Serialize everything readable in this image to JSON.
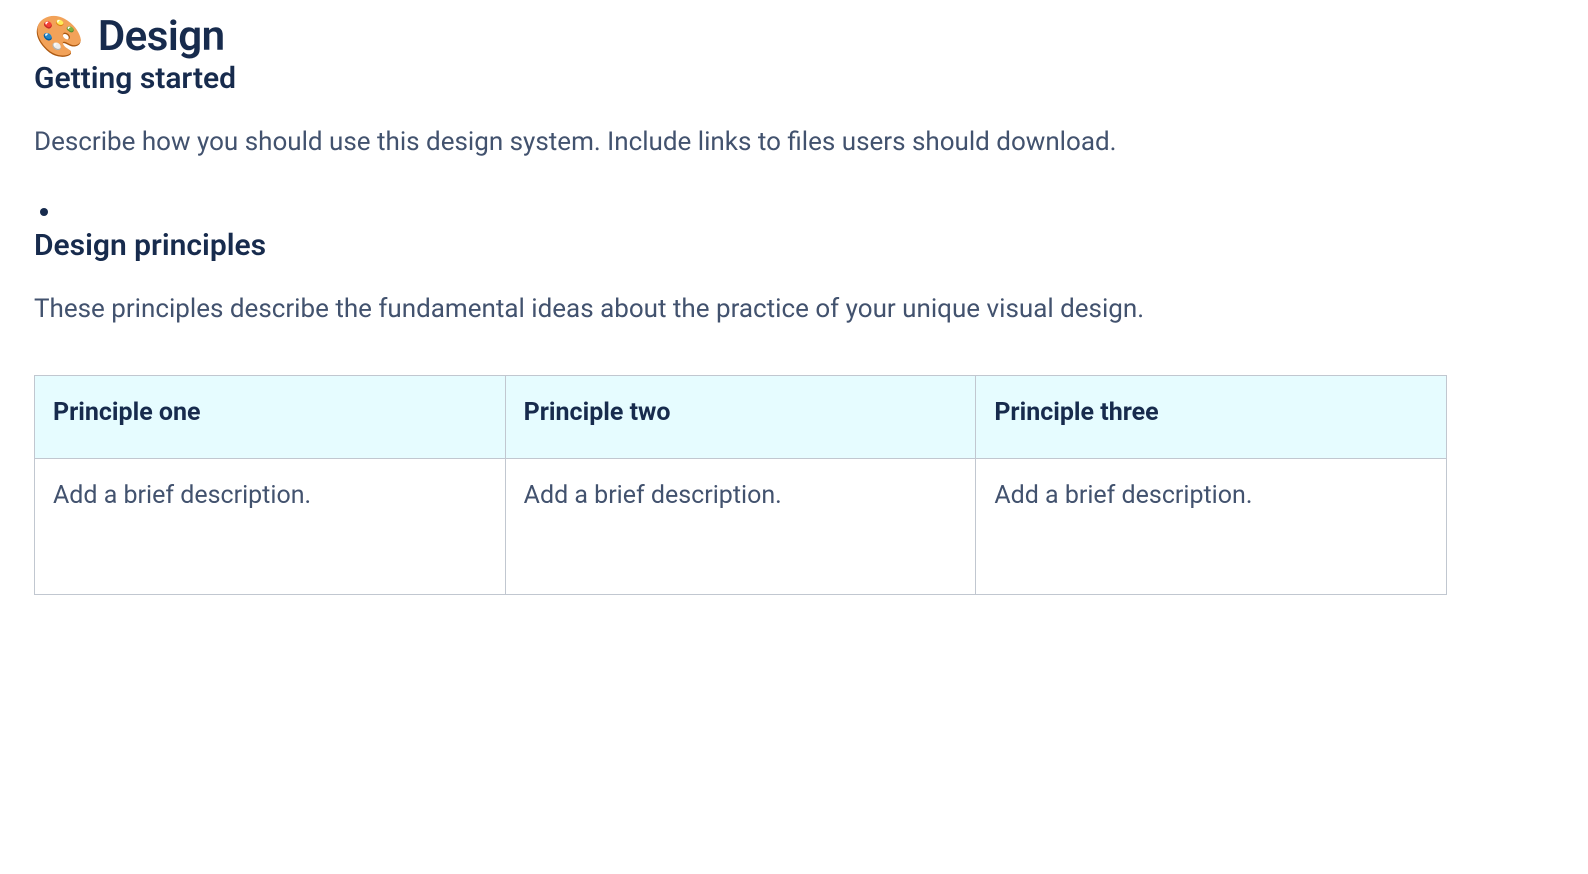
{
  "page": {
    "icon_glyph": "🎨",
    "title": "Design"
  },
  "sections": {
    "getting_started": {
      "heading": "Getting started",
      "helper": "Describe how you should use this design system. Include links to files users should download.",
      "bullets": [
        ""
      ]
    },
    "principles": {
      "heading": "Design principles",
      "helper": "These principles describe the fundamental ideas about the practice of your unique visual design.",
      "columns": [
        {
          "header": "Principle one",
          "body": "Add a brief description."
        },
        {
          "header": "Principle two",
          "body": "Add a brief description."
        },
        {
          "header": "Principle three",
          "body": "Add a brief description."
        }
      ]
    }
  },
  "colors": {
    "text_primary": "#172B4D",
    "text_secondary": "#42526E",
    "table_header_bg": "#E6FCFF",
    "table_border": "#C1C7D0"
  }
}
